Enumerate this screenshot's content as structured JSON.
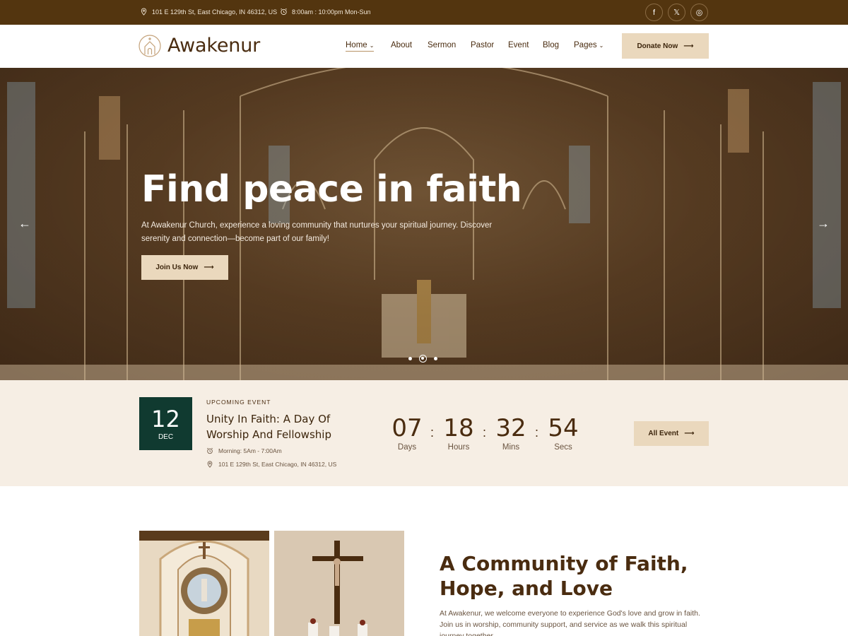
{
  "topbar": {
    "address": "101 E 129th St, East Chicago, IN 46312, US",
    "hours": "8:00am : 10:00pm Mon-Sun",
    "social": [
      {
        "icon": "facebook-icon",
        "glyph": "f"
      },
      {
        "icon": "x-icon",
        "glyph": "𝕏"
      },
      {
        "icon": "instagram-icon",
        "glyph": "◎"
      }
    ]
  },
  "header": {
    "logo": "Awakenur",
    "nav": [
      {
        "label": "Home",
        "active": true,
        "dropdown": true
      },
      {
        "label": "About"
      },
      {
        "label": "Sermon"
      },
      {
        "label": "Pastor"
      },
      {
        "label": "Event"
      },
      {
        "label": "Blog"
      },
      {
        "label": "Pages",
        "dropdown": true
      }
    ],
    "donate": "Donate Now"
  },
  "hero": {
    "title": "Find peace in faith",
    "description": "At Awakenur Church, experience a loving community that nurtures your spiritual journey. Discover serenity and connection—become part of our family!",
    "cta": "Join Us Now",
    "slides": 3,
    "active_slide": 2
  },
  "event": {
    "day": "12",
    "month": "DEC",
    "label": "UPCOMING EVENT",
    "title": "Unity In Faith: A Day Of Worship And Fellowship",
    "time": "Morning: 5Am - 7:00Am",
    "location": "101 E 129th St, East Chicago, IN 46312, US",
    "countdown": [
      {
        "value": "07",
        "unit": "Days"
      },
      {
        "value": "18",
        "unit": "Hours"
      },
      {
        "value": "32",
        "unit": "Mins"
      },
      {
        "value": "54",
        "unit": "Secs"
      }
    ],
    "all_event": "All Event"
  },
  "about": {
    "title": "A Community of Faith, Hope, and Love",
    "text": "At Awakenur, we welcome everyone to experience God's love and grow in faith. Join us in worship, community support, and service as we walk this spiritual journey together."
  },
  "colors": {
    "topbar": "#53350f",
    "brand_text": "#4a2c10",
    "button": "#ead8bd",
    "event_bg": "#f6eee4",
    "date_box": "#103a30"
  }
}
